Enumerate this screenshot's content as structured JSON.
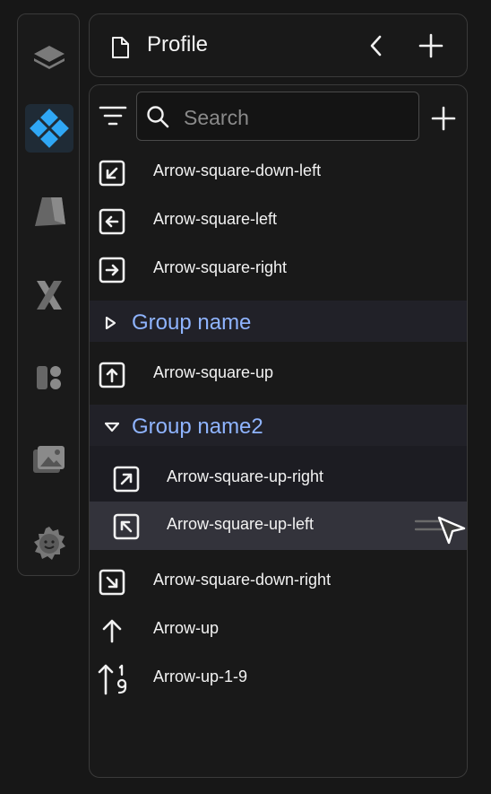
{
  "header": {
    "title": "Profile"
  },
  "search": {
    "placeholder": "Search"
  },
  "items": [
    {
      "label": "Arrow-square-down-left",
      "icon": "arrow-square-down-left-icon"
    },
    {
      "label": "Arrow-square-left",
      "icon": "arrow-square-left-icon"
    },
    {
      "label": "Arrow-square-right",
      "icon": "arrow-square-right-icon"
    }
  ],
  "group1": {
    "name": "Group name",
    "expanded": false
  },
  "item_after_group1": {
    "label": "Arrow-square-up",
    "icon": "arrow-square-up-icon"
  },
  "group2": {
    "name": "Group name2",
    "expanded": true,
    "items": [
      {
        "label": "Arrow-square-up-right",
        "icon": "arrow-square-up-right-icon"
      },
      {
        "label": "Arrow-square-up-left",
        "icon": "arrow-square-up-left-icon",
        "highlighted": true
      }
    ]
  },
  "items_after": [
    {
      "label": "Arrow-square-down-right",
      "icon": "arrow-square-down-right-icon"
    },
    {
      "label": "Arrow-up",
      "icon": "arrow-up-icon"
    },
    {
      "label": "Arrow-up-1-9",
      "icon": "arrow-up-1-9-icon"
    }
  ],
  "colors": {
    "group_label": "#8fb4ff",
    "accent": "#3aa0f0",
    "background": "#171717"
  }
}
